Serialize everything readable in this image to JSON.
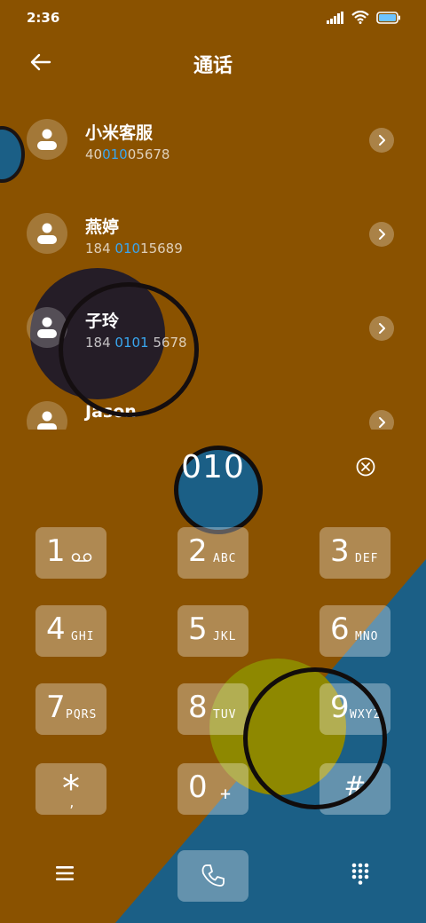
{
  "status_bar": {
    "time": "2:36"
  },
  "header": {
    "title": "通话",
    "back_icon": "back-arrow-icon"
  },
  "contacts": [
    {
      "name": "小米客服",
      "num_pre": "40",
      "num_hl": "010",
      "num_post": "05678"
    },
    {
      "name": "燕婷",
      "num_pre": "184 ",
      "num_hl": "010",
      "num_post": "15689"
    },
    {
      "name": "子玲",
      "num_pre": "184 ",
      "num_hl": "0101",
      "num_post": " 5678"
    },
    {
      "name": "Jason",
      "num_pre": "",
      "num_hl": "",
      "num_post": ""
    }
  ],
  "dial_input": {
    "value": "010"
  },
  "keys": [
    {
      "digit": "1",
      "letters": ""
    },
    {
      "digit": "2",
      "letters": "ABC"
    },
    {
      "digit": "3",
      "letters": "DEF"
    },
    {
      "digit": "4",
      "letters": "GHI"
    },
    {
      "digit": "5",
      "letters": "JKL"
    },
    {
      "digit": "6",
      "letters": "MNO"
    },
    {
      "digit": "7",
      "letters": "PQRS"
    },
    {
      "digit": "8",
      "letters": "TUV"
    },
    {
      "digit": "9",
      "letters": "WXYZ"
    },
    {
      "digit": "*",
      "letters": ","
    },
    {
      "digit": "0",
      "letters": "+"
    },
    {
      "digit": "#",
      "letters": ""
    }
  ],
  "bottom_bar": {
    "menu_icon": "menu-icon",
    "call_icon": "phone-icon",
    "keypad_icon": "dialpad-icon"
  },
  "colors": {
    "background": "#8a5200",
    "triangle": "#1b5f86",
    "highlight": "#39a7f0"
  }
}
